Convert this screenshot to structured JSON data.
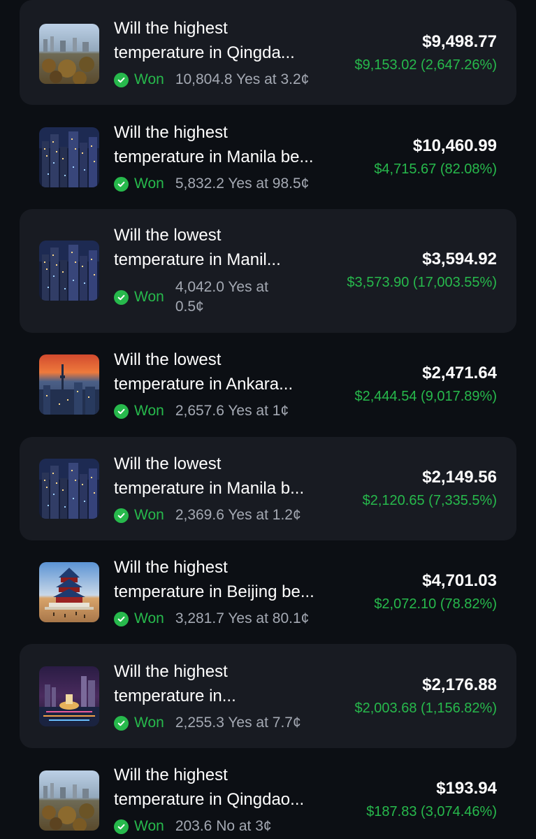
{
  "colors": {
    "background": "#0c0f14",
    "card": "#181b22",
    "positive": "#27b94c",
    "muted": "#a4a9b3"
  },
  "positions": [
    {
      "title_line1": "Will the highest",
      "title_line2": "temperature in Qingda...",
      "status": "Won",
      "shares": "10,804.8 Yes at 3.2¢",
      "value": "$9,498.77",
      "pnl": "$9,153.02 (2,647.26%)",
      "icon": "qingdao-city-thumbnail"
    },
    {
      "title_line1": "Will the highest",
      "title_line2": "temperature in Manila be...",
      "status": "Won",
      "shares": "5,832.2 Yes at 98.5¢",
      "value": "$10,460.99",
      "pnl": "$4,715.67 (82.08%)",
      "icon": "manila-city-thumbnail"
    },
    {
      "title_line1": "Will the lowest",
      "title_line2": "temperature in Manil...",
      "status": "Won",
      "shares": "4,042.0 Yes at 0.5¢",
      "value": "$3,594.92",
      "pnl": "$3,573.90 (17,003.55%)",
      "icon": "manila-city-thumbnail"
    },
    {
      "title_line1": "Will the lowest",
      "title_line2": "temperature in Ankara...",
      "status": "Won",
      "shares": "2,657.6 Yes at 1¢",
      "value": "$2,471.64",
      "pnl": "$2,444.54 (9,017.89%)",
      "icon": "ankara-city-thumbnail"
    },
    {
      "title_line1": "Will the lowest",
      "title_line2": "temperature in Manila b...",
      "status": "Won",
      "shares": "2,369.6 Yes at 1.2¢",
      "value": "$2,149.56",
      "pnl": "$2,120.65 (7,335.5%)",
      "icon": "manila-city-thumbnail"
    },
    {
      "title_line1": "Will the highest",
      "title_line2": "temperature in Beijing be...",
      "status": "Won",
      "shares": "3,281.7 Yes at 80.1¢",
      "value": "$4,701.03",
      "pnl": "$2,072.10 (78.82%)",
      "icon": "beijing-temple-thumbnail"
    },
    {
      "title_line1": "Will the highest",
      "title_line2": "temperature in...",
      "status": "Won",
      "shares": "2,255.3 Yes at 7.7¢",
      "value": "$2,176.88",
      "pnl": "$2,003.68 (1,156.82%)",
      "icon": "singapore-city-thumbnail"
    },
    {
      "title_line1": "Will the highest",
      "title_line2": "temperature in Qingdao...",
      "status": "Won",
      "shares": "203.6 No at 3¢",
      "value": "$193.94",
      "pnl": "$187.83 (3,074.46%)",
      "icon": "qingdao-city-thumbnail"
    }
  ]
}
